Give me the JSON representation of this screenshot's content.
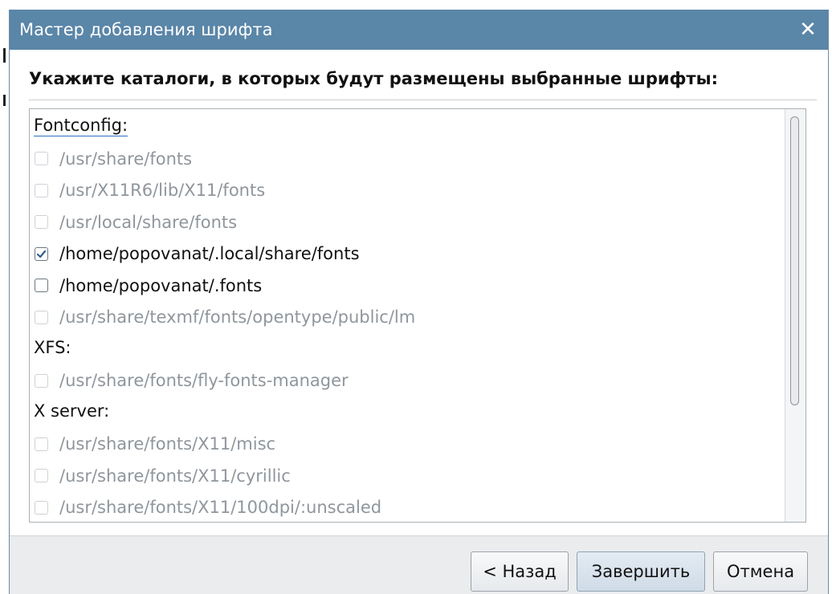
{
  "window": {
    "title": "Мастер добавления шрифта",
    "close_glyph": "✕"
  },
  "heading": "Укажите каталоги, в которых будут размещены выбранные шрифты:",
  "groups": [
    {
      "label": "Fontconfig:",
      "items": [
        {
          "path": "/usr/share/fonts",
          "checked": false,
          "enabled": false
        },
        {
          "path": "/usr/X11R6/lib/X11/fonts",
          "checked": false,
          "enabled": false
        },
        {
          "path": "/usr/local/share/fonts",
          "checked": false,
          "enabled": false
        },
        {
          "path": "/home/popovanat/.local/share/fonts",
          "checked": true,
          "enabled": true
        },
        {
          "path": "/home/popovanat/.fonts",
          "checked": false,
          "enabled": true
        },
        {
          "path": "/usr/share/texmf/fonts/opentype/public/lm",
          "checked": false,
          "enabled": false
        }
      ]
    },
    {
      "label": "XFS:",
      "items": [
        {
          "path": "/usr/share/fonts/fly-fonts-manager",
          "checked": false,
          "enabled": false
        }
      ]
    },
    {
      "label": "X server:",
      "items": [
        {
          "path": "/usr/share/fonts/X11/misc",
          "checked": false,
          "enabled": false
        },
        {
          "path": "/usr/share/fonts/X11/cyrillic",
          "checked": false,
          "enabled": false
        },
        {
          "path": "/usr/share/fonts/X11/100dpi/:unscaled",
          "checked": false,
          "enabled": false
        }
      ]
    }
  ],
  "buttons": {
    "back": "< Назад",
    "finish": "Завершить",
    "cancel": "Отмена"
  },
  "colors": {
    "titlebar": "#5a86a8",
    "disabled_text": "#8f969c",
    "check_mark": "#2f5f8f"
  }
}
